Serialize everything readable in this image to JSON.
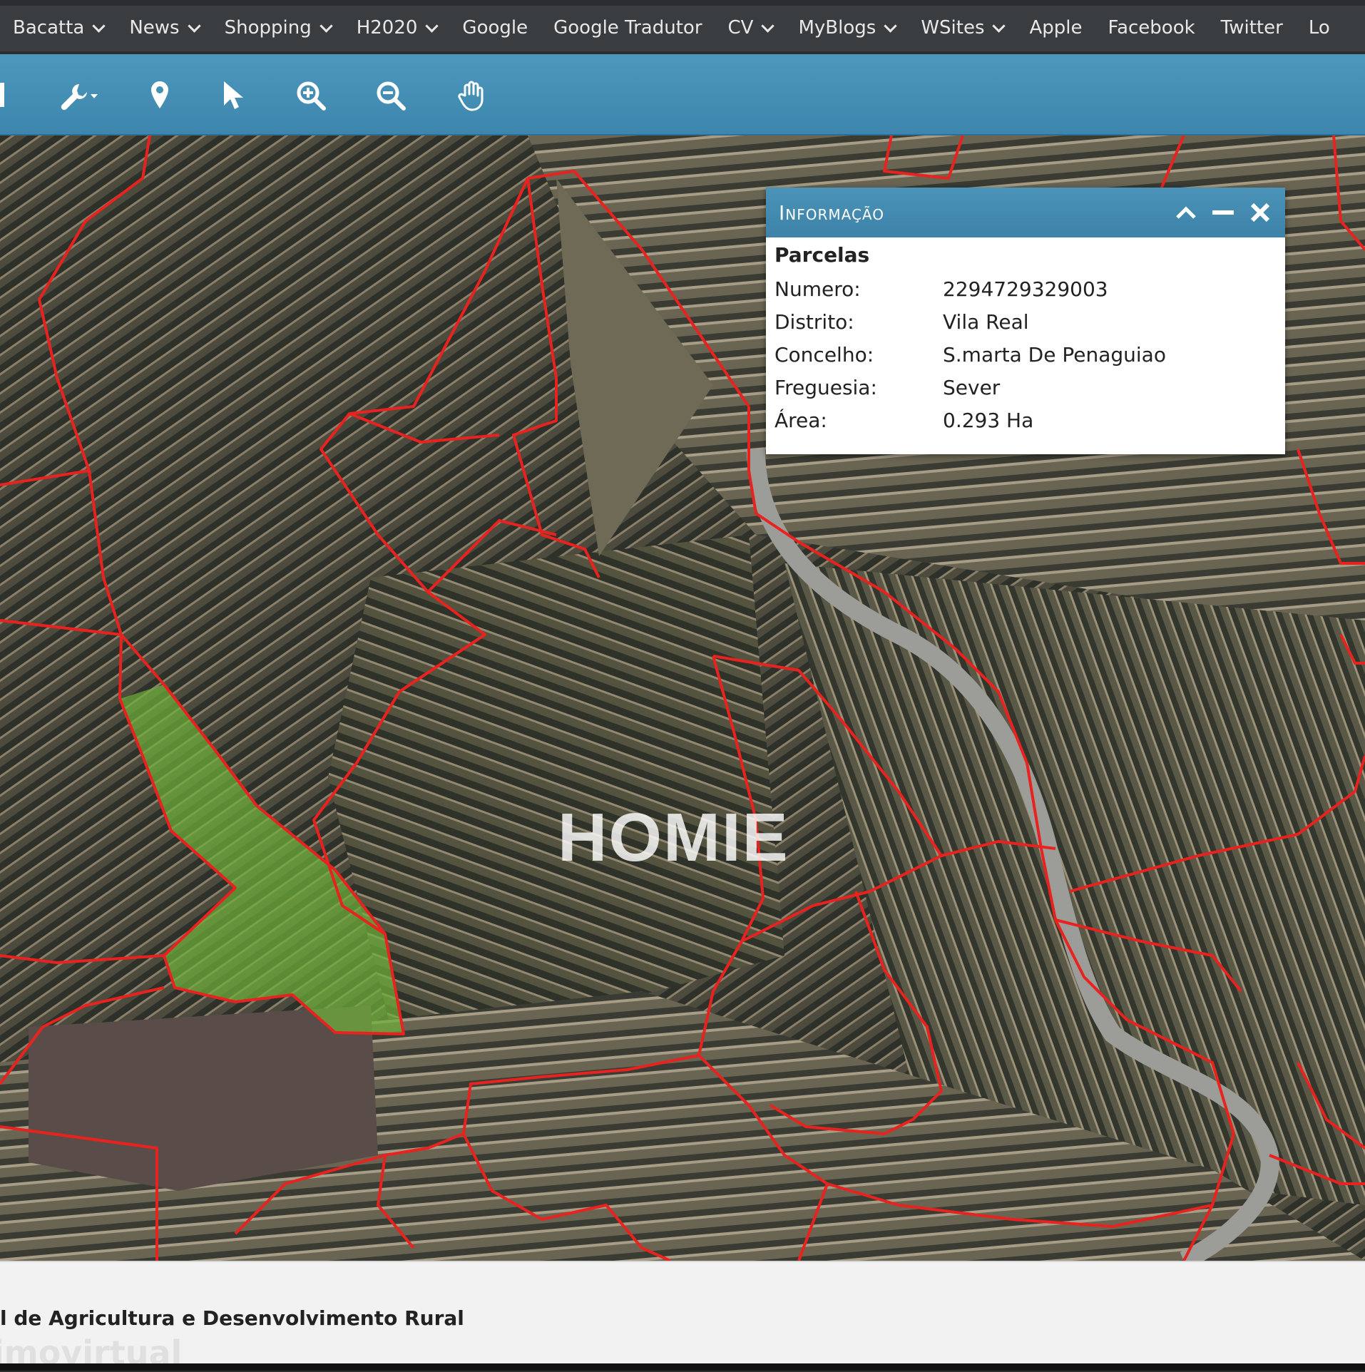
{
  "bookmarks": [
    {
      "label": "Bacatta",
      "dropdown": true
    },
    {
      "label": "News",
      "dropdown": true
    },
    {
      "label": "Shopping",
      "dropdown": true
    },
    {
      "label": "H2020",
      "dropdown": true
    },
    {
      "label": "Google",
      "dropdown": false
    },
    {
      "label": "Google Tradutor",
      "dropdown": false
    },
    {
      "label": "CV",
      "dropdown": true
    },
    {
      "label": "MyBlogs",
      "dropdown": true
    },
    {
      "label": "WSites",
      "dropdown": true
    },
    {
      "label": "Apple",
      "dropdown": false
    },
    {
      "label": "Facebook",
      "dropdown": false
    },
    {
      "label": "Twitter",
      "dropdown": false
    },
    {
      "label": "Lo",
      "dropdown": false
    }
  ],
  "toolbar": {
    "tools": [
      "wrench-dropdown-icon",
      "map-pin-icon",
      "pointer-icon",
      "zoom-in-icon",
      "zoom-out-icon",
      "pan-hand-icon"
    ]
  },
  "map": {
    "watermark": "HOMIE",
    "boundary_color": "#e8231f",
    "highlight_color": "#6fae3a"
  },
  "info_panel": {
    "title": "Informação",
    "section": "Parcelas",
    "rows": [
      {
        "label": "Numero:",
        "value": "2294729329003"
      },
      {
        "label": "Distrito:",
        "value": "Vila Real"
      },
      {
        "label": "Concelho:",
        "value": "S.marta De Penaguiao"
      },
      {
        "label": "Freguesia:",
        "value": "Sever"
      },
      {
        "label": "Área:",
        "value": "0.293 Ha"
      }
    ]
  },
  "footer": {
    "text": "l de Agricultura e Desenvolvimento Rural",
    "ghost": "imovirtual"
  }
}
